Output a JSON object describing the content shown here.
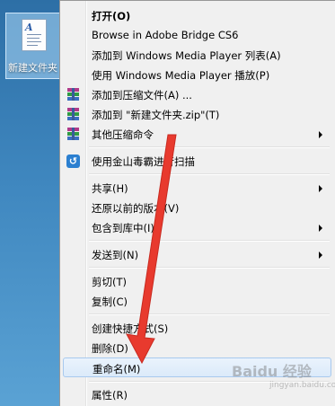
{
  "desktop": {
    "icon_label": "新建文件夹"
  },
  "menu": {
    "items": [
      {
        "label": "打开(O)"
      },
      {
        "label": "Browse in Adobe Bridge CS6"
      },
      {
        "label": "添加到 Windows Media Player 列表(A)"
      },
      {
        "label": "使用 Windows Media Player 播放(P)"
      },
      {
        "label": "添加到压缩文件(A) ..."
      },
      {
        "label": "添加到 \"新建文件夹.zip\"(T)"
      },
      {
        "label": "其他压缩命令"
      },
      {
        "label": "使用金山毒霸进行扫描"
      },
      {
        "label": "共享(H)"
      },
      {
        "label": "还原以前的版本(V)"
      },
      {
        "label": "包含到库中(I)"
      },
      {
        "label": "发送到(N)"
      },
      {
        "label": "剪切(T)"
      },
      {
        "label": "复制(C)"
      },
      {
        "label": "创建快捷方式(S)"
      },
      {
        "label": "删除(D)"
      },
      {
        "label": "重命名(M)"
      },
      {
        "label": "属性(R)"
      }
    ]
  },
  "colors": {
    "highlight_border": "#a8c9ee",
    "arrow": "#e83a2e"
  },
  "watermark": {
    "text": "Baidu 经验",
    "sub": "jingyan.baidu.com"
  }
}
